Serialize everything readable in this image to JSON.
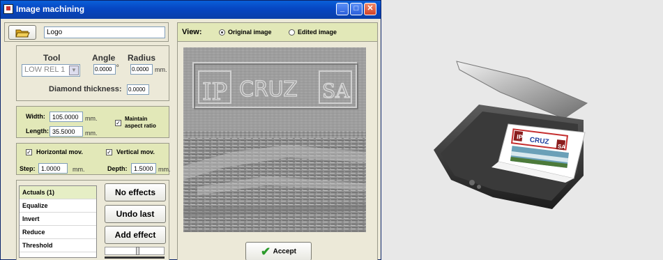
{
  "window": {
    "title": "Image machining"
  },
  "file": {
    "name_value": "Logo"
  },
  "view": {
    "label": "View:",
    "original_label": "Original image",
    "edited_label": "Edited image",
    "selected": "original"
  },
  "tool": {
    "tool_label": "Tool",
    "angle_label": "Angle",
    "radius_label": "Radius",
    "tool_value": "LOW REL 1",
    "angle_value": "0.0000",
    "angle_unit": "º",
    "radius_value": "0.0000",
    "radius_unit": "mm.",
    "diamond_label": "Diamond thickness:",
    "diamond_value": "0.0000"
  },
  "size": {
    "width_label": "Width:",
    "width_value": "105.0000",
    "width_unit": "mm.",
    "length_label": "Length:",
    "length_value": "35.5000",
    "length_unit": "mm.",
    "maintain_label_1": "Maintain",
    "maintain_label_2": "aspect ratio",
    "maintain_checked": true
  },
  "movement": {
    "horizontal_label": "Horizontal mov.",
    "horizontal_checked": true,
    "vertical_label": "Vertical mov.",
    "vertical_checked": true,
    "step_label": "Step:",
    "step_value": "1.0000",
    "step_unit": "mm.",
    "depth_label": "Depth:",
    "depth_value": "1.5000",
    "depth_unit": "mm."
  },
  "effects": {
    "list": [
      "Actuals (1)",
      "Equalize",
      "Invert",
      "Reduce",
      "Threshold"
    ],
    "selected_index": 0,
    "no_effects_label": "No effects",
    "undo_label": "Undo last",
    "add_label": "Add effect"
  },
  "accept": {
    "label": "Accept"
  },
  "preview": {
    "logo_text_left": "IP",
    "logo_text_center": "CRUZ",
    "logo_text_right": "SA"
  },
  "scanner_sheet": {
    "logo_text": "CRUZ",
    "logo_left": "IP",
    "logo_right": "SA"
  },
  "colors": {
    "title_blue": "#0646c2",
    "panel_green": "#e2e8b8",
    "accept_check": "#2a9a2a"
  },
  "icons": [
    "open-folder-icon",
    "minimize-icon",
    "maximize-icon",
    "close-icon",
    "checkmark-icon"
  ]
}
